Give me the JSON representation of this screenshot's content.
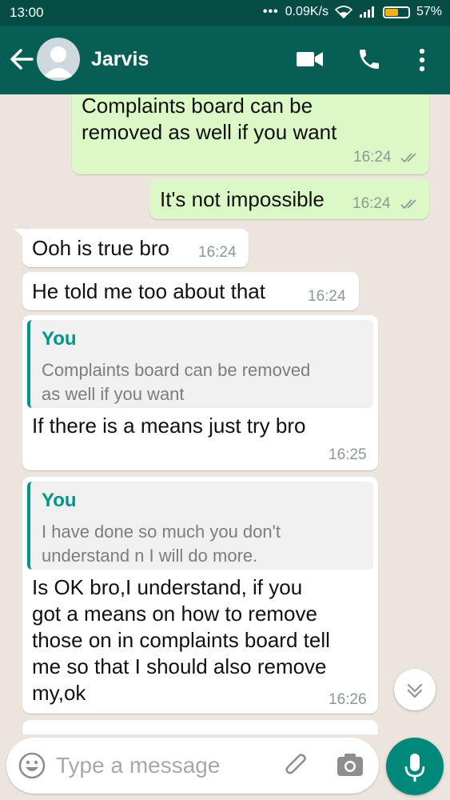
{
  "status_bar": {
    "time": "13:00",
    "network_speed": "0.09K/s",
    "battery": "57%",
    "battery_level": 0.57
  },
  "header": {
    "contact_name": "Jarvis",
    "icons": [
      "back-arrow-icon",
      "avatar",
      "video-call-icon",
      "phone-icon",
      "more-vert-icon"
    ]
  },
  "messages": [
    {
      "dir": "out",
      "lines": [
        "Complaints board can be",
        "removed as well if you want"
      ],
      "time": "16:24",
      "status": "read"
    },
    {
      "dir": "out",
      "text": "It's not impossible",
      "time": "16:24",
      "status": "read"
    },
    {
      "dir": "in",
      "text": "Ooh is true bro",
      "time": "16:24"
    },
    {
      "dir": "in",
      "text": "He told me too about that",
      "time": "16:24"
    },
    {
      "dir": "in",
      "quote": {
        "author": "You",
        "lines": [
          "Complaints board can be removed",
          "as well if you want"
        ]
      },
      "text": "If there is a means just try bro",
      "time": "16:25"
    },
    {
      "dir": "in",
      "quote": {
        "author": "You",
        "lines": [
          "I have done so much you don't",
          "understand n I will do more."
        ]
      },
      "lines": [
        "Is OK bro,I understand, if you",
        "got a means on how to remove",
        "those on in complaints board tell",
        "me so that I should also remove",
        "my,ok"
      ],
      "time": "16:26"
    }
  ],
  "input": {
    "placeholder": "Type a message"
  },
  "colors": {
    "header": "#075E54",
    "status_bar": "#054D44",
    "outgoing": "#DCF8C6",
    "incoming": "#FFFFFF",
    "accent": "#009688",
    "chat_bg": "#ECE5DD"
  }
}
